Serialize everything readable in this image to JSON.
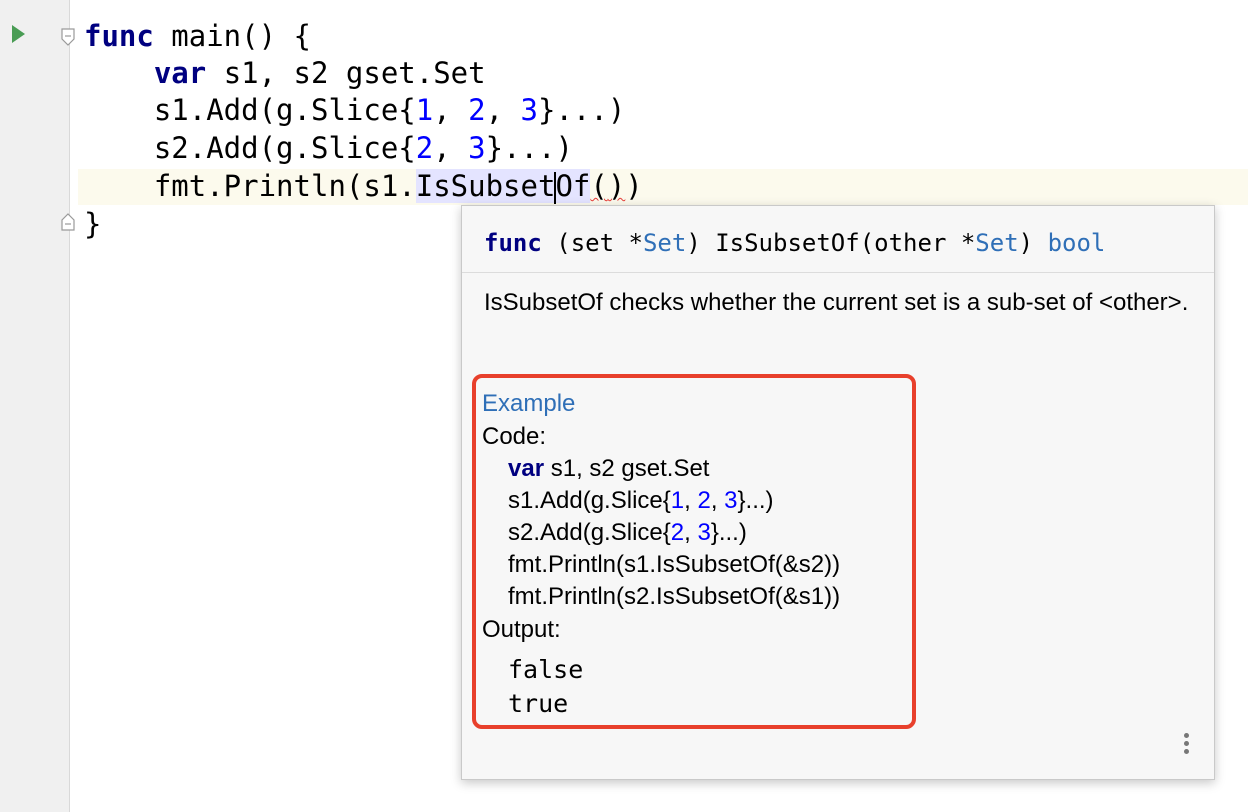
{
  "code": {
    "line1": {
      "kw": "func",
      "rest": " main() {"
    },
    "line2": {
      "indent": "    ",
      "kw": "var",
      "rest": " s1, s2 gset.Set"
    },
    "line3": {
      "indent": "    ",
      "pre": "s1.Add(g.Slice{",
      "n1": "1",
      "s1": ", ",
      "n2": "2",
      "s2": ", ",
      "n3": "3",
      "post": "}...)"
    },
    "line4": {
      "indent": "    ",
      "pre": "s2.Add(g.Slice{",
      "n1": "2",
      "s1": ", ",
      "n2": "3",
      "post": "}...)"
    },
    "line5": {
      "indent": "    ",
      "pre": "fmt.Println(s1.",
      "hl_a": "IsSubset",
      "hl_b": "Of",
      "paren_open": "(",
      "paren_close": ")",
      "close": ")"
    },
    "line6": {
      "text": "}"
    }
  },
  "popup": {
    "signature": {
      "kw": "func",
      "p1": " (set *",
      "type1": "Set",
      "p2": ") IsSubsetOf(other *",
      "type2": "Set",
      "p3": ") ",
      "ret": "bool"
    },
    "description": "IsSubsetOf checks whether the current set is a sub-set of <other>.",
    "example": {
      "title": "Example",
      "code_label": "Code:",
      "l1_kw": "var",
      "l1_rest": " s1, s2 gset.Set",
      "l2_pre": "s1.Add(g.Slice{",
      "l2_n1": "1",
      "l2_s1": ", ",
      "l2_n2": "2",
      "l2_s2": ", ",
      "l2_n3": "3",
      "l2_post": "}...)",
      "l3_pre": "s2.Add(g.Slice{",
      "l3_n1": "2",
      "l3_s1": ", ",
      "l3_n2": "3",
      "l3_post": "}...)",
      "l4": "fmt.Println(s1.IsSubsetOf(&s2))",
      "l5": "fmt.Println(s2.IsSubsetOf(&s1))",
      "output_label": "Output:",
      "out1": "false",
      "out2": "true"
    }
  },
  "icons": {
    "run": "run-arrow-icon",
    "fold": "fold-marker-icon",
    "more": "more-options-icon"
  },
  "colors": {
    "keyword": "#000080",
    "number": "#0000ff",
    "link": "#2f6fb7",
    "highlight_box": "#e8402c",
    "run_icon": "#499c54"
  }
}
